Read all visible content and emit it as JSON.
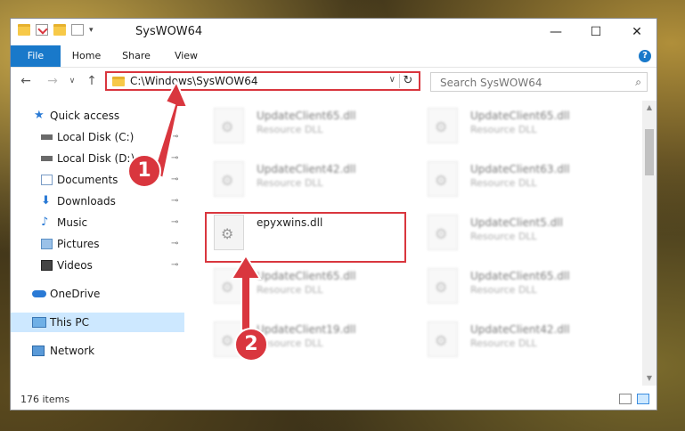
{
  "window": {
    "title": "SysWOW64",
    "controls": {
      "minimize": "—",
      "maximize": "☐",
      "close": "✕"
    }
  },
  "ribbon": {
    "tabs": [
      "File",
      "Home",
      "Share",
      "View"
    ],
    "help": "?"
  },
  "address": {
    "path": "C:\\Windows\\SysWOW64",
    "dropdown": "∨",
    "refresh": "↻"
  },
  "search": {
    "placeholder": "Search SysWOW64",
    "icon": "search-icon"
  },
  "nav": {
    "back": "←",
    "forward": "→",
    "recent": "∨",
    "up": "↑"
  },
  "sidebar": {
    "items": [
      {
        "label": "Quick access",
        "icon": "star-icon",
        "pinned": false
      },
      {
        "label": "Local Disk (C:)",
        "icon": "drive-icon",
        "pinned": true
      },
      {
        "label": "Local Disk (D:)",
        "icon": "drive-icon",
        "pinned": true
      },
      {
        "label": "Documents",
        "icon": "documents-icon",
        "pinned": true
      },
      {
        "label": "Downloads",
        "icon": "download-icon",
        "pinned": true
      },
      {
        "label": "Music",
        "icon": "music-icon",
        "pinned": true
      },
      {
        "label": "Pictures",
        "icon": "pictures-icon",
        "pinned": true
      },
      {
        "label": "Videos",
        "icon": "videos-icon",
        "pinned": true
      },
      {
        "label": "OneDrive",
        "icon": "cloud-icon",
        "pinned": false
      },
      {
        "label": "This PC",
        "icon": "computer-icon",
        "pinned": false
      },
      {
        "label": "Network",
        "icon": "network-icon",
        "pinned": false
      }
    ],
    "pin_glyph": "📌"
  },
  "files": [
    {
      "name": "UpdateClient65.dll",
      "type": "Resource DLL"
    },
    {
      "name": "UpdateClient65.dll",
      "type": "Resource DLL"
    },
    {
      "name": "UpdateClient42.dll",
      "type": "Resource DLL"
    },
    {
      "name": "UpdateClient63.dll",
      "type": "Resource DLL"
    },
    {
      "name": "epyxwins.dll",
      "type": ""
    },
    {
      "name": "UpdateClient5.dll",
      "type": "Resource DLL"
    },
    {
      "name": "UpdateClient65.dll",
      "type": "Resource DLL"
    },
    {
      "name": "UpdateClient65.dll",
      "type": "Resource DLL"
    },
    {
      "name": "UpdateClient19.dll",
      "type": "Resource DLL"
    },
    {
      "name": "UpdateClient42.dll",
      "type": "Resource DLL"
    }
  ],
  "status": {
    "count": "176 items"
  },
  "annotations": {
    "marker1": "1",
    "marker2": "2",
    "color": "#d9363e"
  }
}
